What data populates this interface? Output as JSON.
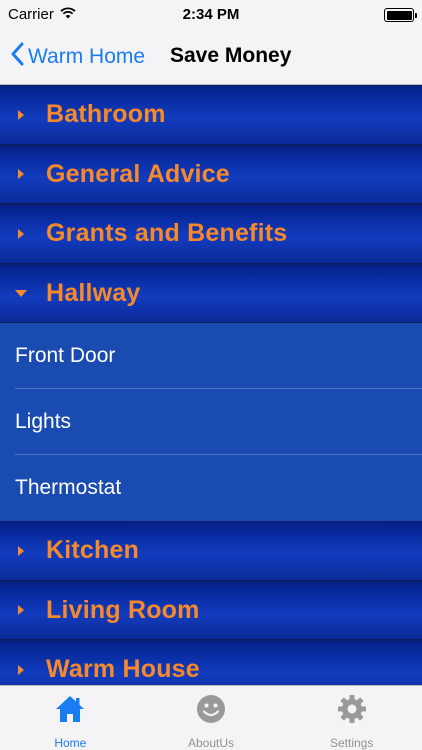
{
  "status_bar": {
    "carrier": "Carrier",
    "time": "2:34 PM"
  },
  "nav": {
    "back_label": "Warm Home",
    "title": "Save Money"
  },
  "sections_top": [
    {
      "label": "Bathroom",
      "expanded": false
    },
    {
      "label": "General Advice",
      "expanded": false
    },
    {
      "label": "Grants and Benefits",
      "expanded": false
    },
    {
      "label": "Hallway",
      "expanded": true
    }
  ],
  "hallway_items": [
    {
      "label": "Front Door"
    },
    {
      "label": "Lights"
    },
    {
      "label": "Thermostat"
    }
  ],
  "sections_bottom": [
    {
      "label": "Kitchen",
      "expanded": false
    },
    {
      "label": "Living Room",
      "expanded": false
    },
    {
      "label": "Warm House",
      "expanded": false
    }
  ],
  "tabs": [
    {
      "label": "Home",
      "icon": "home-icon",
      "active": true
    },
    {
      "label": "AboutUs",
      "icon": "smiley-icon",
      "active": false
    },
    {
      "label": "Settings",
      "icon": "gear-icon",
      "active": false
    }
  ],
  "colors": {
    "accent": "#1a7cf2",
    "section_text": "#f7892a",
    "list_background": "#1a4bb0",
    "inactive_tab": "#929292"
  }
}
